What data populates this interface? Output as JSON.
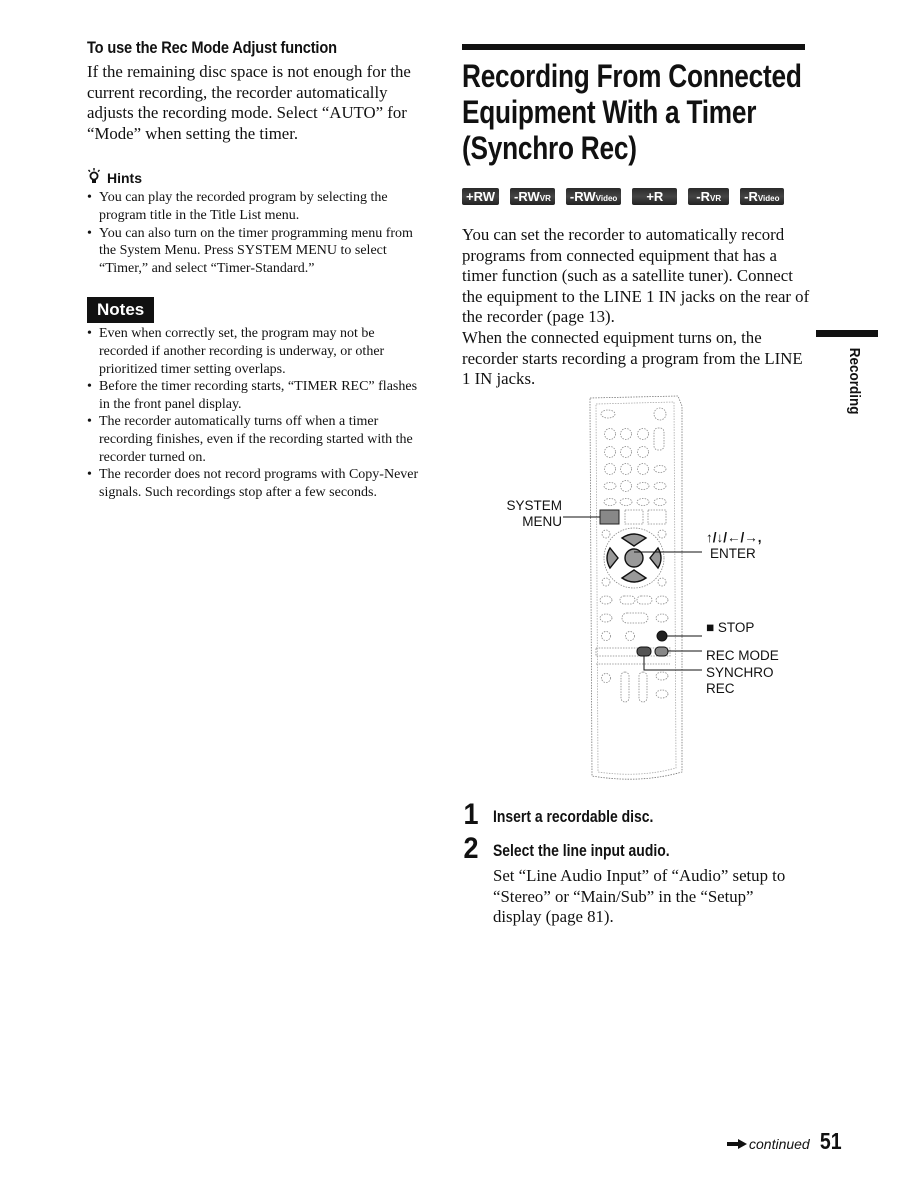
{
  "left": {
    "rec_mode_heading": "To use the Rec Mode Adjust function",
    "rec_mode_body": "If the remaining disc space is not enough for the current recording, the recorder automatically adjusts the recording mode. Select “AUTO” for “Mode” when setting the timer.",
    "hints": {
      "icon": "lightbulb-icon",
      "label": "Hints",
      "items": [
        "You can play the recorded program by selecting the program title in the Title List menu.",
        "You can also turn on the timer programming menu from the System Menu. Press SYSTEM MENU to select “Timer,” and select “Timer-Standard.”"
      ]
    },
    "notes": {
      "label": "Notes",
      "items": [
        "Even when correctly set, the program may not be recorded if another recording is underway, or other prioritized timer setting overlaps.",
        "Before the timer recording starts, “TIMER REC” flashes in the front panel display.",
        "The recorder automatically turns off when a timer recording finishes, even if the recording started with the recorder turned on.",
        "The recorder does not record programs with Copy-Never signals. Such recordings stop after a few seconds."
      ]
    }
  },
  "right": {
    "title_lines": [
      "Recording From Connected",
      "Equipment With a Timer",
      "(Synchro Rec)"
    ],
    "disc_types": [
      {
        "main": "+RW",
        "sub": ""
      },
      {
        "main": "-RW",
        "sub": "VR"
      },
      {
        "main": "-RW",
        "sub": "Video"
      },
      {
        "main": "+R",
        "sub": ""
      },
      {
        "main": "-R",
        "sub": "VR"
      },
      {
        "main": "-R",
        "sub": "Video"
      }
    ],
    "intro_p1": "You can set the recorder to automatically record programs from connected equipment that has a timer function (such as a satellite tuner). Connect the equipment to the LINE 1 IN jacks on the rear of the recorder (page 13).",
    "intro_p2": "When the connected equipment turns on, the recorder starts recording a program from the LINE 1 IN jacks."
  },
  "remote_diagram": {
    "callouts": {
      "system_menu": [
        "SYSTEM",
        "MENU"
      ],
      "arrows": "↑/↓/←/→,",
      "enter": "ENTER",
      "stop": "■ STOP",
      "rec_mode": "REC MODE",
      "synchro_rec": [
        "SYNCHRO",
        "REC"
      ]
    }
  },
  "steps": [
    {
      "number": "1",
      "title": "Insert a recordable disc.",
      "body": ""
    },
    {
      "number": "2",
      "title": "Select the line input audio.",
      "body": "Set “Line Audio Input” of “Audio” setup to “Stereo” or “Main/Sub” in the “Setup” display (page 81)."
    }
  ],
  "side_tab": {
    "label": "Recording"
  },
  "footer": {
    "continued": "continued",
    "continued_icon": "arrow-right-icon",
    "page_number": "51"
  }
}
